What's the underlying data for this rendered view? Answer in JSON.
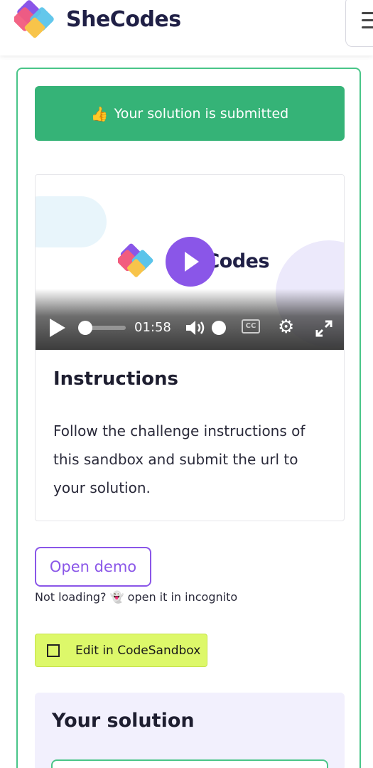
{
  "header": {
    "brand": "SheCodes",
    "menu_icon": "hamburger-icon"
  },
  "status": {
    "emoji": "👍",
    "text": "Your solution is submitted",
    "color": "#35b377"
  },
  "video": {
    "brand": "SheCodes",
    "time": "01:58",
    "cc_label": "CC",
    "progress": 0.0
  },
  "instructions": {
    "title": "Instructions",
    "body": "Follow the challenge instructions of this sandbox and submit the url to your solution."
  },
  "demo": {
    "button_label": "Open demo",
    "not_loading_prefix": "Not loading?",
    "ghost_emoji": "👻",
    "not_loading_suffix": "open it in incognito"
  },
  "sandbox": {
    "button_label": "Edit in CodeSandbox"
  },
  "solution": {
    "title": "Your solution"
  },
  "colors": {
    "accent_green": "#35b377",
    "purple": "#8a56e8",
    "lime": "#ddf86a"
  }
}
